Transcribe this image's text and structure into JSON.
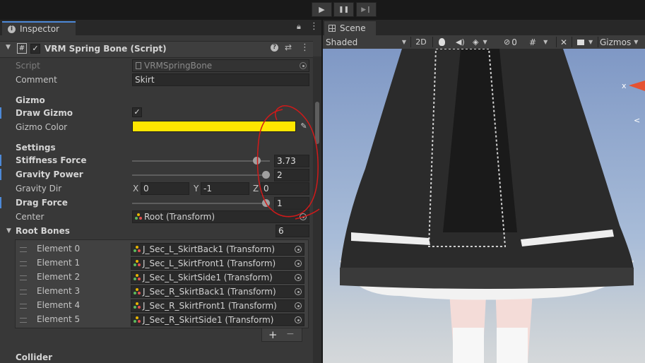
{
  "toolbar": {
    "play": "▶",
    "pause": "❚❚",
    "step": "▶❙"
  },
  "inspector": {
    "tab_label": "Inspector",
    "component_title": "VRM Spring Bone (Script)",
    "script_label": "Script",
    "script_value": "VRMSpringBone",
    "comment_label": "Comment",
    "comment_value": "Skirt",
    "gizmo_section": "Gizmo",
    "draw_gizmo_label": "Draw Gizmo",
    "draw_gizmo_check": "✓",
    "gizmo_color_label": "Gizmo Color",
    "gizmo_color": "#ffe600",
    "settings_section": "Settings",
    "stiffness_label": "Stiffness Force",
    "stiffness_value": "3.73",
    "stiffness_level": 0.93,
    "gravity_power_label": "Gravity Power",
    "gravity_power_value": "2",
    "gravity_power_level": 1.0,
    "gravity_dir_label": "Gravity Dir",
    "gravity_dir": {
      "x_label": "X",
      "x": "0",
      "y_label": "Y",
      "y": "-1",
      "z_label": "Z",
      "z": "0"
    },
    "drag_force_label": "Drag Force",
    "drag_force_value": "1",
    "drag_force_level": 1.0,
    "center_label": "Center",
    "center_value": "Root (Transform)",
    "root_bones_label": "Root Bones",
    "root_bones_count": "6",
    "root_bones": [
      {
        "label": "Element 0",
        "value": "J_Sec_L_SkirtBack1 (Transform)"
      },
      {
        "label": "Element 1",
        "value": "J_Sec_L_SkirtFront1 (Transform)"
      },
      {
        "label": "Element 2",
        "value": "J_Sec_L_SkirtSide1 (Transform)"
      },
      {
        "label": "Element 3",
        "value": "J_Sec_R_SkirtBack1 (Transform)"
      },
      {
        "label": "Element 4",
        "value": "J_Sec_R_SkirtFront1 (Transform)"
      },
      {
        "label": "Element 5",
        "value": "J_Sec_R_SkirtSide1 (Transform)"
      }
    ],
    "add_label": "+",
    "remove_label": "−",
    "collider_label": "Collider"
  },
  "scene": {
    "tab_label": "Scene",
    "shading_mode": "Shaded",
    "mode_2d": "2D",
    "hidden_count": "0",
    "gizmos_label": "Gizmos",
    "axis_x_label": "x"
  }
}
